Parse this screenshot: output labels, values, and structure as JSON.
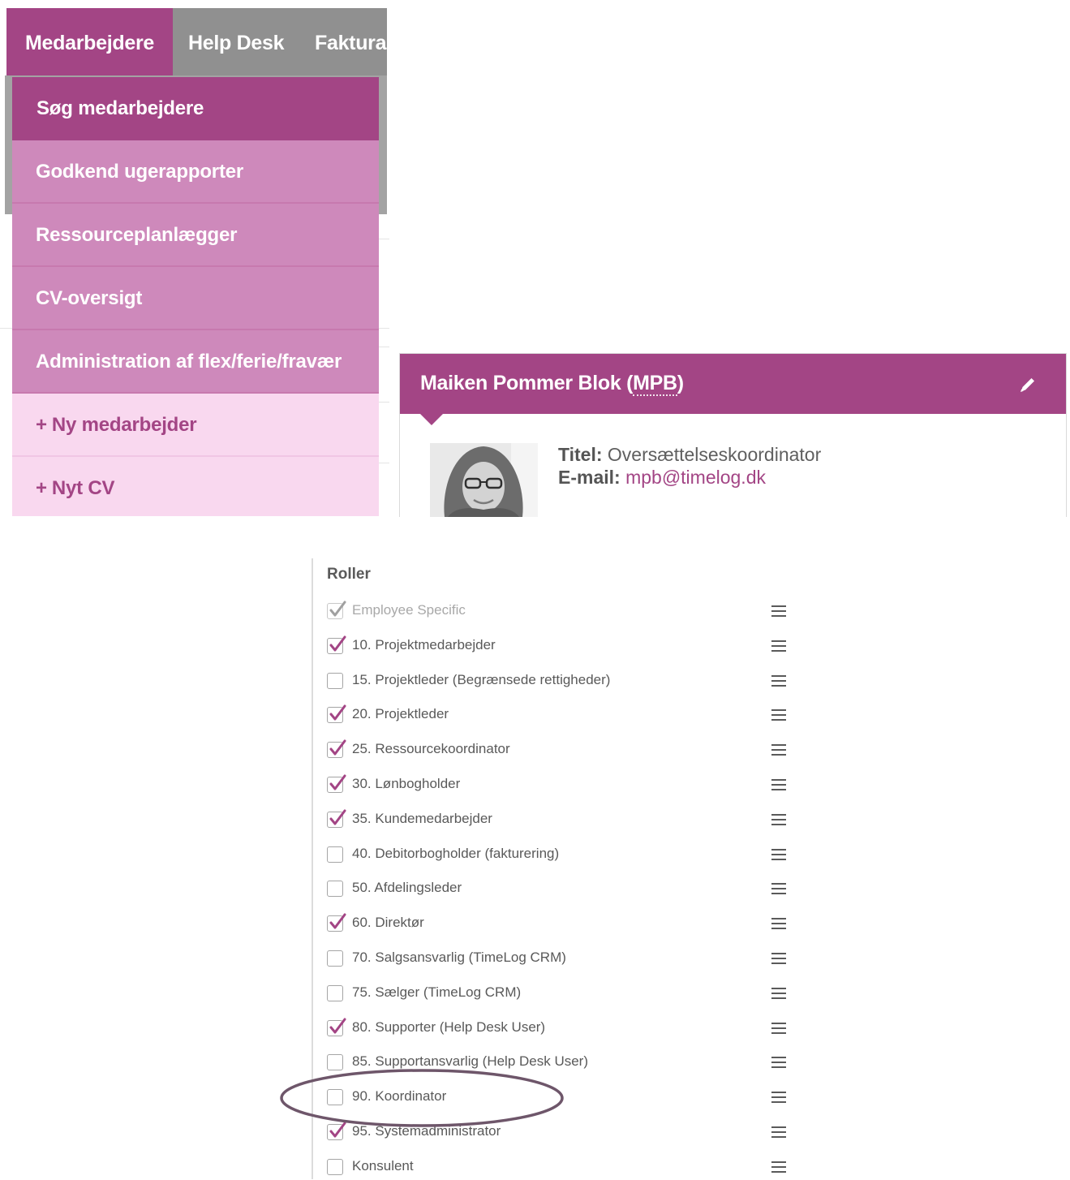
{
  "nav": {
    "tabs": [
      {
        "label": "Medarbejdere",
        "active": true
      },
      {
        "label": "Help Desk",
        "active": false
      },
      {
        "label": "Faktura",
        "active": false
      }
    ]
  },
  "menu": {
    "items": [
      {
        "label": "Søg medarbejdere",
        "type": "active"
      },
      {
        "label": "Godkend ugerapporter",
        "type": "normal"
      },
      {
        "label": "Ressourceplanlægger",
        "type": "normal"
      },
      {
        "label": "CV-oversigt",
        "type": "normal"
      },
      {
        "label": "Administration af flex/ferie/fravær",
        "type": "normal"
      },
      {
        "label": "Ny medarbejder",
        "type": "add"
      },
      {
        "label": "Nyt CV",
        "type": "add"
      }
    ],
    "add_prefix": "+"
  },
  "profile": {
    "name": "Maiken Pommer Blok",
    "initials": "MPB",
    "title_label": "Titel:",
    "title_value": "Oversættelseskoordinator",
    "email_label": "E-mail:",
    "email_value": "mpb@timelog.dk"
  },
  "roles": {
    "heading": "Roller",
    "items": [
      {
        "label": "Employee Specific",
        "checked": true,
        "disabled": true
      },
      {
        "label": "10. Projektmedarbejder",
        "checked": true
      },
      {
        "label": "15. Projektleder (Begrænsede rettigheder)",
        "checked": false
      },
      {
        "label": "20. Projektleder",
        "checked": true
      },
      {
        "label": "25. Ressourcekoordinator",
        "checked": true
      },
      {
        "label": "30. Lønbogholder",
        "checked": true
      },
      {
        "label": "35. Kundemedarbejder",
        "checked": true
      },
      {
        "label": "40. Debitorbogholder (fakturering)",
        "checked": false
      },
      {
        "label": "50. Afdelingsleder",
        "checked": false
      },
      {
        "label": "60. Direktør",
        "checked": true
      },
      {
        "label": "70. Salgsansvarlig (TimeLog CRM)",
        "checked": false
      },
      {
        "label": "75. Sælger (TimeLog CRM)",
        "checked": false
      },
      {
        "label": "80. Supporter (Help Desk User)",
        "checked": true
      },
      {
        "label": "85. Supportansvarlig (Help Desk User)",
        "checked": false
      },
      {
        "label": "90. Koordinator",
        "checked": false,
        "highlighted": true
      },
      {
        "label": "95. Systemadministrator",
        "checked": true
      },
      {
        "label": "Konsulent",
        "checked": false
      }
    ]
  },
  "colors": {
    "brand": "#a34585",
    "menu_normal": "#ce89bb",
    "menu_add": "#f9d8ef",
    "nav_bg": "#909090",
    "highlight_ellipse": "#6e566a"
  },
  "icons": {
    "edit": "pencil-icon",
    "reorder": "hamburger-menu-icon",
    "check": "checkmark-icon"
  }
}
